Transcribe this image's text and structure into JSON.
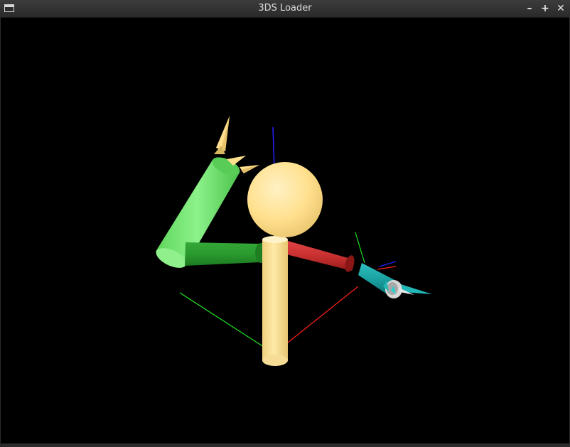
{
  "window": {
    "title": "3DS Loader",
    "controls": {
      "minimize": "–",
      "maximize": "+",
      "close": "✕"
    }
  },
  "scene": {
    "background": "#000000",
    "colors": {
      "body": "#ffe08e",
      "upper_arm_green": "#6ee66a",
      "forearm_green": "#2a9a2e",
      "arm_red": "#c83030",
      "cone_cyan": "#1aa0a0",
      "axis_x": "#ff2020",
      "axis_y": "#20e020",
      "axis_z": "#2020ff"
    }
  }
}
